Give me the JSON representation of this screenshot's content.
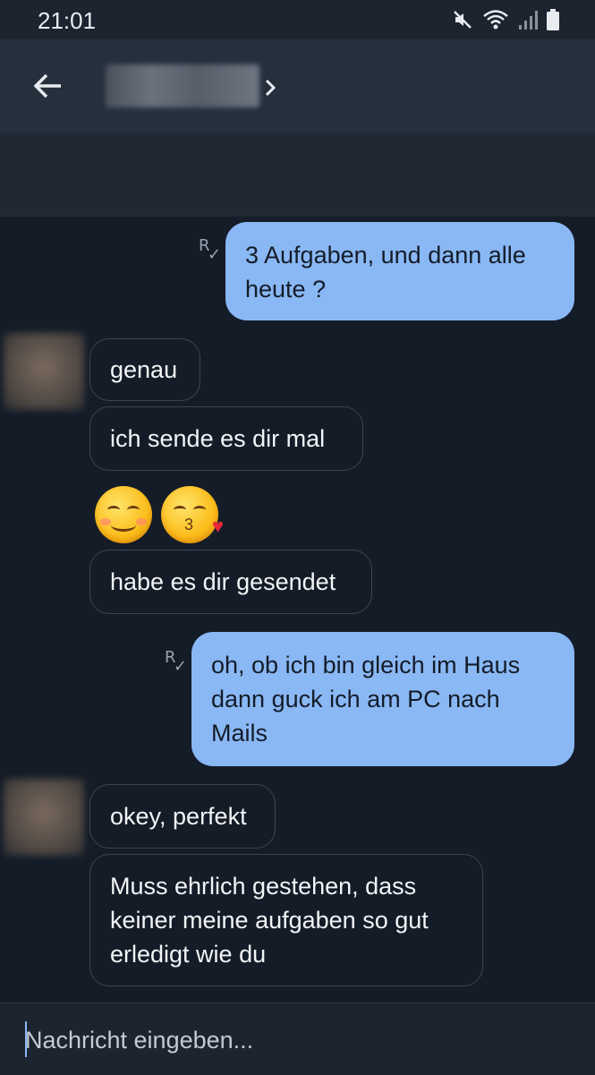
{
  "status_bar": {
    "time": "21:01",
    "icons": [
      "mute-icon",
      "wifi-icon",
      "signal-icon",
      "battery-icon"
    ]
  },
  "header": {
    "back_icon": "arrow-left-icon",
    "contact_name": "",
    "chevron_icon": "chevron-right-icon"
  },
  "messages": [
    {
      "direction": "out",
      "text": "3 Aufgaben, und dann alle heute ?",
      "read_mark": "R"
    },
    {
      "direction": "in",
      "text": "genau"
    },
    {
      "direction": "in",
      "text": "ich sende es dir mal"
    },
    {
      "direction": "in",
      "type": "emoji",
      "emojis": [
        "smiling-face-icon",
        "face-blowing-kiss-icon"
      ]
    },
    {
      "direction": "in",
      "text": "habe es dir gesendet"
    },
    {
      "direction": "out",
      "text": "oh, ob ich bin gleich im Haus dann guck ich am PC nach Mails",
      "read_mark": "R"
    },
    {
      "direction": "in",
      "text": "okey, perfekt"
    },
    {
      "direction": "in",
      "text": "Muss ehrlich gestehen, dass keiner meine aufgaben so gut erledigt wie du"
    }
  ],
  "composer": {
    "placeholder": "Nachricht eingeben..."
  },
  "colors": {
    "background": "#141c28",
    "outgoing_bubble": "#8ab8f5",
    "incoming_border": "#3b4552",
    "app_bar": "#26303c"
  }
}
